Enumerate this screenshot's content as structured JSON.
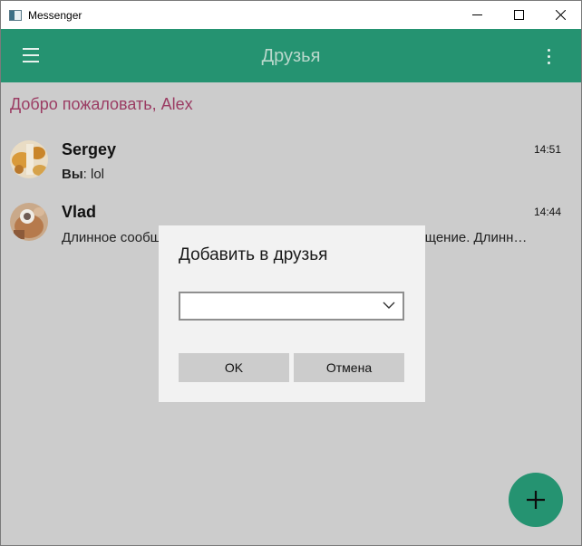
{
  "window": {
    "title": "Messenger"
  },
  "appbar": {
    "title": "Друзья"
  },
  "welcome": "Добро пожаловать, Alex",
  "chats": [
    {
      "name": "Sergey",
      "time": "14:51",
      "sender": "Вы",
      "separator": ": ",
      "message": "lol"
    },
    {
      "name": "Vlad",
      "time": "14:44",
      "message": "Длинное сообщение. Длинное сообщение. Длинное сообщение. Длинное сообщение. Длинное сообщение. Длинное со..."
    }
  ],
  "dialog": {
    "title": "Добавить в друзья",
    "combo_value": "",
    "ok_label": "OK",
    "cancel_label": "Отмена"
  },
  "colors": {
    "accent": "#259371",
    "welcome_text": "#9b3c63",
    "background": "#cccccc"
  },
  "icons": {
    "menu": "hamburger-icon",
    "more": "more-vertical-icon",
    "add": "plus-icon",
    "dropdown": "chevron-down-icon"
  }
}
